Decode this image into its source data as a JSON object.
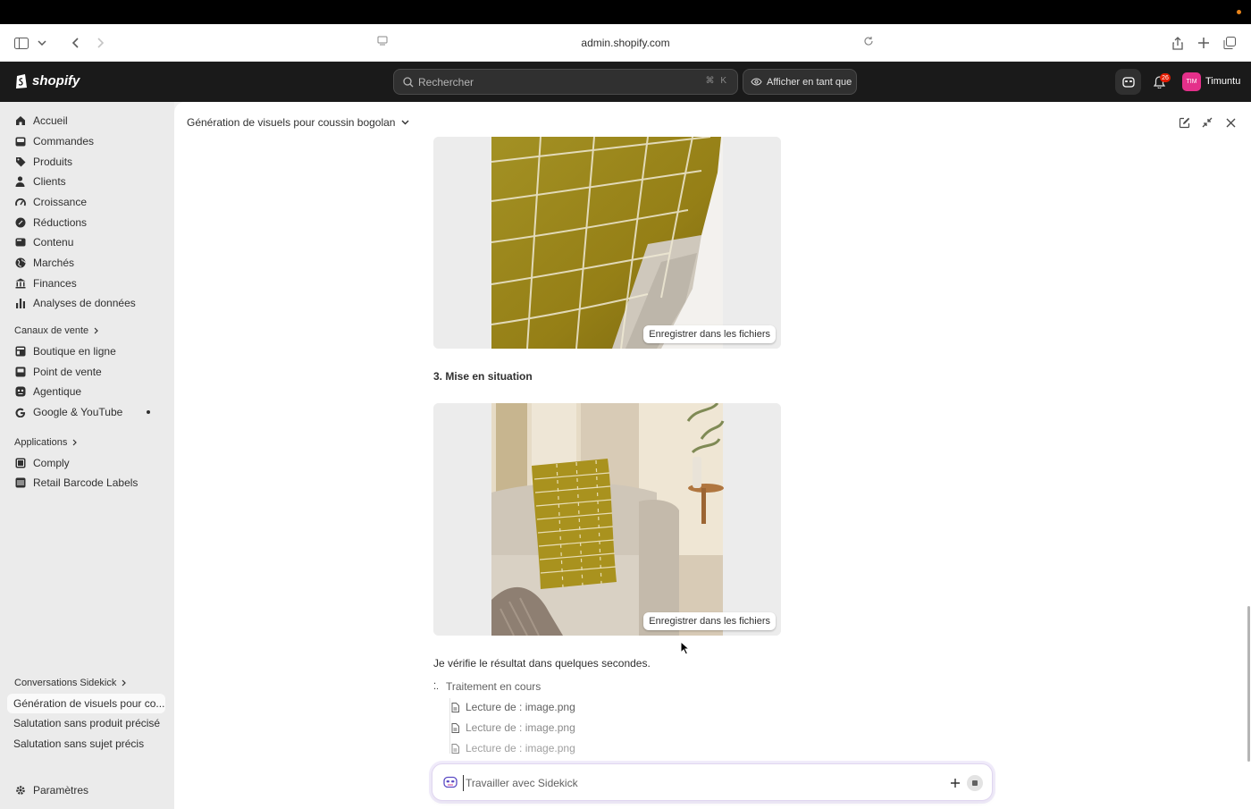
{
  "browser": {
    "url": "admin.shopify.com"
  },
  "topbar": {
    "logo_text": "shopify",
    "search_placeholder": "Rechercher",
    "search_shortcut": "⌘ K",
    "view_as_label": "Afficher en tant que",
    "notification_count": "26",
    "avatar_initials": "TIM",
    "store_name": "Timuntu"
  },
  "sidebar": {
    "main_items": [
      {
        "label": "Accueil",
        "icon": "home-icon"
      },
      {
        "label": "Commandes",
        "icon": "inbox-icon"
      },
      {
        "label": "Produits",
        "icon": "tag-icon"
      },
      {
        "label": "Clients",
        "icon": "person-icon"
      },
      {
        "label": "Croissance",
        "icon": "gauge-icon"
      },
      {
        "label": "Réductions",
        "icon": "discount-icon"
      },
      {
        "label": "Contenu",
        "icon": "content-icon"
      },
      {
        "label": "Marchés",
        "icon": "globe-icon"
      },
      {
        "label": "Finances",
        "icon": "bank-icon"
      },
      {
        "label": "Analyses de données",
        "icon": "bar-chart-icon"
      }
    ],
    "sales_channels_label": "Canaux de vente",
    "sales_channels": [
      {
        "label": "Boutique en ligne",
        "icon": "store-icon"
      },
      {
        "label": "Point de vente",
        "icon": "pos-icon"
      },
      {
        "label": "Agentique",
        "icon": "agent-icon"
      },
      {
        "label": "Google & YouTube",
        "icon": "google-icon"
      }
    ],
    "apps_label": "Applications",
    "apps": [
      {
        "label": "Comply",
        "icon": "app-icon"
      },
      {
        "label": "Retail Barcode Labels",
        "icon": "barcode-icon"
      }
    ],
    "conversations_label": "Conversations Sidekick",
    "conversations": [
      {
        "label": "Génération de visuels pour co..."
      },
      {
        "label": "Salutation sans produit précisé"
      },
      {
        "label": "Salutation sans sujet précis"
      }
    ],
    "settings_label": "Paramètres"
  },
  "main": {
    "conversation_title": "Génération de visuels pour coussin bogolan",
    "save_label_1": "Enregistrer dans les fichiers",
    "section_heading": "3. Mise en situation",
    "save_label_2": "Enregistrer dans les fichiers",
    "message": "Je vérifie le résultat dans quelques secondes.",
    "processing_label": "Traitement en cours",
    "read_items": [
      {
        "label": "Lecture de : image.png"
      },
      {
        "label": "Lecture de : image.png"
      },
      {
        "label": "Lecture de : image.png"
      }
    ],
    "composer_placeholder": "Travailler avec Sidekick"
  },
  "colors": {
    "topbar": "#1a1a1a",
    "sidebar": "#ebebeb",
    "fabric_mustard": "#9c8a1e",
    "avatar": "#e4308a",
    "badge": "#e51c00"
  }
}
